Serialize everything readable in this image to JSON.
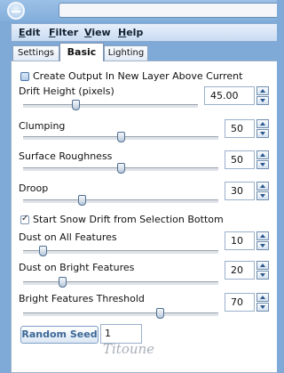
{
  "menu": [
    "Edit",
    "Filter",
    "View",
    "Help"
  ],
  "tabs": {
    "settings": "Settings",
    "basic": "Basic",
    "lighting": "Lighting"
  },
  "checkbox_output": {
    "label": "Create Output In New Layer Above Current",
    "checked": false
  },
  "checkbox_snow": {
    "label": "Start Snow Drift from Selection Bottom",
    "checked": true
  },
  "params": [
    {
      "label": "Drift Height (pixels)",
      "value": "45.00",
      "slider_fraction": 0.3
    },
    {
      "label": "Clumping",
      "value": "50",
      "slider_fraction": 0.5
    },
    {
      "label": "Surface Roughness",
      "value": "50",
      "slider_fraction": 0.5
    },
    {
      "label": "Droop",
      "value": "30",
      "slider_fraction": 0.3
    },
    {
      "label": "Dust on All Features",
      "value": "10",
      "slider_fraction": 0.1
    },
    {
      "label": "Dust on Bright Features",
      "value": "20",
      "slider_fraction": 0.2
    },
    {
      "label": "Bright Features Threshold",
      "value": "70",
      "slider_fraction": 0.7
    }
  ],
  "random_seed": {
    "label": "Random Seed",
    "value": "1"
  },
  "watermark": "Titoune"
}
